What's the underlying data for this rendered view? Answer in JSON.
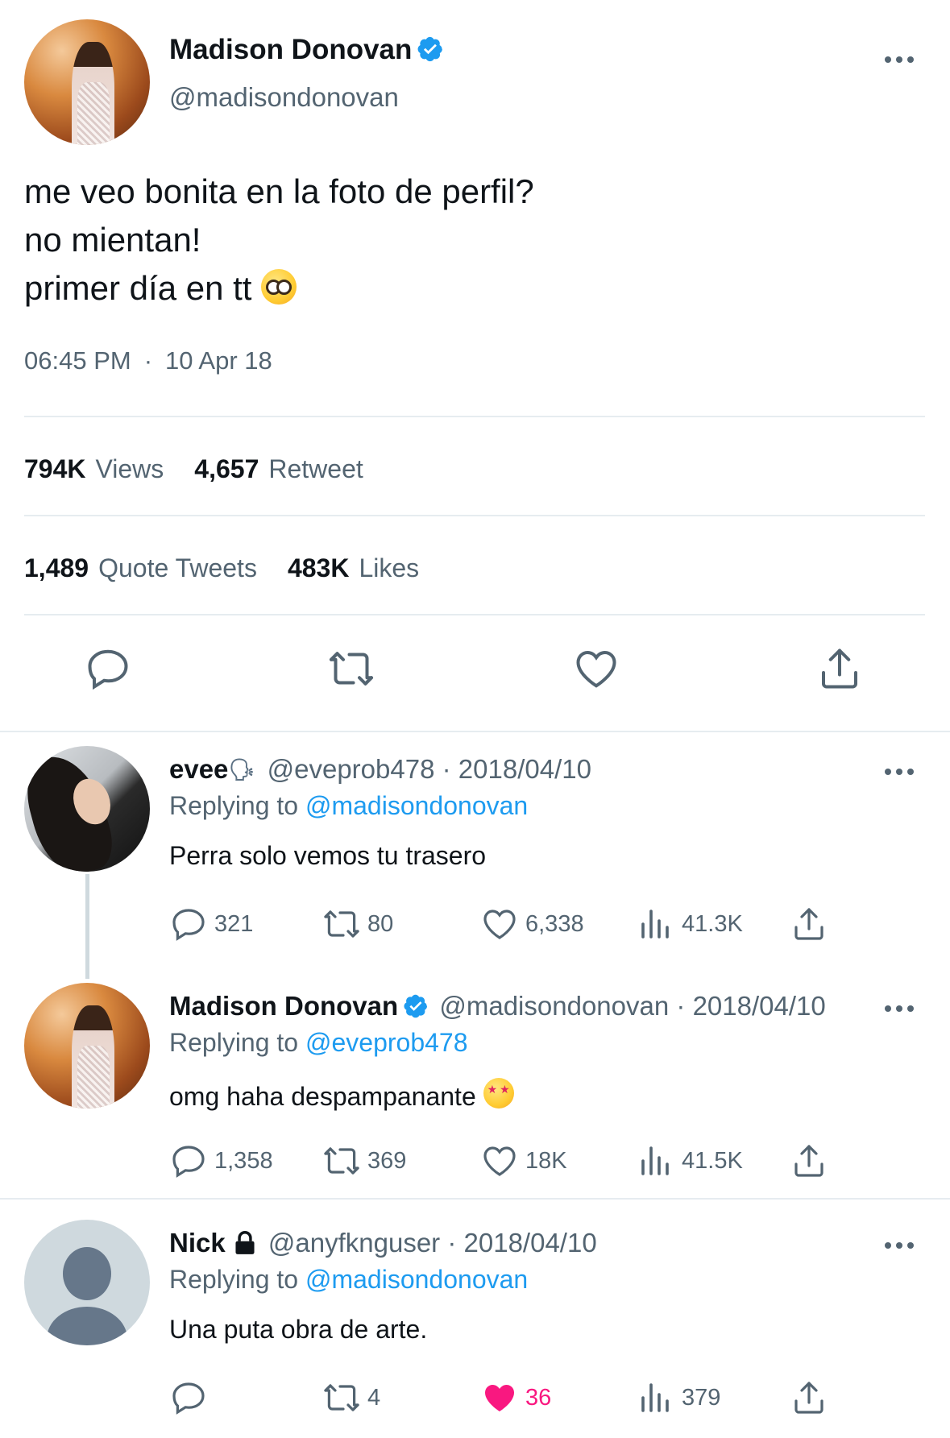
{
  "main_tweet": {
    "author_name": "Madison Donovan",
    "author_handle": "@madisondonovan",
    "text_lines": [
      "me veo bonita en la foto de perfil?",
      "no mientan!",
      "primer día en tt"
    ],
    "time": "06:45 PM",
    "date": "10 Apr 18",
    "stats": {
      "views_value": "794K",
      "views_label": "Views",
      "retweets_value": "4,657",
      "retweets_label": "Retweet",
      "quotes_value": "1,489",
      "quotes_label": "Quote Tweets",
      "likes_value": "483K",
      "likes_label": "Likes"
    }
  },
  "replies": [
    {
      "author_name": "evee",
      "author_handle": "@eveprob478",
      "date": "2018/04/10",
      "replying_label": "Replying to",
      "replying_to": "@madisondonovan",
      "text": "Perra solo vemos tu trasero",
      "replies": "321",
      "retweets": "80",
      "likes": "6,338",
      "views": "41.3K"
    },
    {
      "author_name": "Madison Donovan",
      "author_handle": "@madisondonovan",
      "date": "2018/04/10",
      "replying_label": "Replying to",
      "replying_to": "@eveprob478",
      "text": "omg haha despampanante",
      "replies": "1,358",
      "retweets": "369",
      "likes": "18K",
      "views": "41.5K"
    },
    {
      "author_name": "Nick",
      "author_handle": "@anyfknguser",
      "date": "2018/04/10",
      "replying_label": "Replying to",
      "replying_to": "@madisondonovan",
      "text": "Una puta obra de arte.",
      "replies": "",
      "retweets": "4",
      "likes": "36",
      "views": "379"
    }
  ],
  "colors": {
    "accent_blue": "#1d9bf0",
    "like_pink": "#f91880",
    "secondary_text": "#536471",
    "divider": "#e6ecf0"
  },
  "icons": [
    "verified-badge-icon",
    "more-options-icon",
    "reply-icon",
    "retweet-icon",
    "like-icon",
    "share-icon",
    "views-icon",
    "lock-icon",
    "speaking-head-icon"
  ]
}
